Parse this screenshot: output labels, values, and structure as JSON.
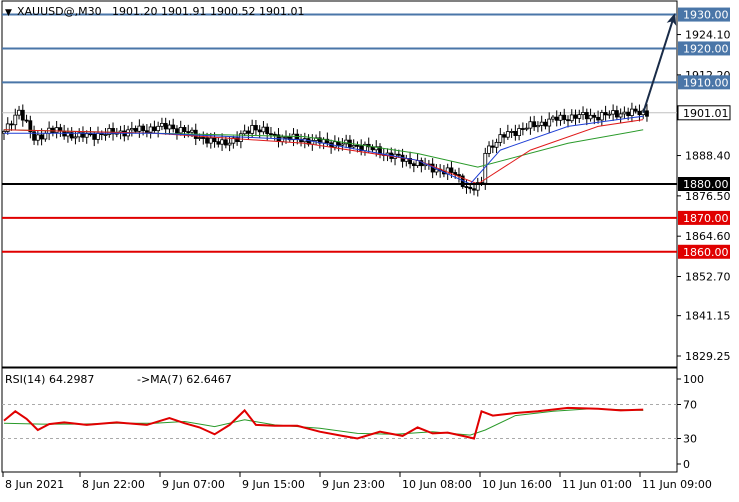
{
  "header": {
    "menu_glyph": "▼",
    "symbol": "XAUUSD@,M30",
    "ohlc": "1901.20 1901.91 1900.52 1901.01"
  },
  "colors": {
    "bull_candle": "#ffffff",
    "bear_candle": "#000000",
    "ma_fast": "#1f3fd6",
    "ma_mid": "#e01b1b",
    "ma_slow": "#2a9a2a",
    "level_blue": "#4a76a8",
    "level_red": "#e00000",
    "level_black": "#000000",
    "rsi_line": "#e00000",
    "rsi_ma": "#2a9a2a",
    "arrow": "#1a2c48"
  },
  "chart_data": [
    {
      "type": "candlestick",
      "title": "XAUUSD@,M30",
      "ylim": [
        1826,
        1934
      ],
      "y_ticks": [
        "1924.10",
        "1912.20",
        "1888.40",
        "1876.50",
        "1864.60",
        "1852.70",
        "1841.15",
        "1829.25"
      ],
      "x_ticks": [
        "8 Jun 2021",
        "8 Jun 22:00",
        "9 Jun 07:00",
        "9 Jun 15:00",
        "9 Jun 23:00",
        "10 Jun 08:00",
        "10 Jun 16:00",
        "11 Jun 01:00",
        "11 Jun 09:00"
      ],
      "current_price": "1901.01",
      "levels": [
        {
          "value": 1930.0,
          "label": "1930.00",
          "color": "blue"
        },
        {
          "value": 1920.0,
          "label": "1920.00",
          "color": "blue"
        },
        {
          "value": 1910.0,
          "label": "1910.00",
          "color": "blue"
        },
        {
          "value": 1880.0,
          "label": "1880.00",
          "color": "black"
        },
        {
          "value": 1870.0,
          "label": "1870.00",
          "color": "red"
        },
        {
          "value": 1860.0,
          "label": "1860.00",
          "color": "red"
        }
      ],
      "close_path": [
        [
          0,
          1895
        ],
        [
          4,
          1902
        ],
        [
          8,
          1893
        ],
        [
          12,
          1896
        ],
        [
          20,
          1894
        ],
        [
          28,
          1895
        ],
        [
          36,
          1896
        ],
        [
          44,
          1897
        ],
        [
          52,
          1894
        ],
        [
          56,
          1892
        ],
        [
          62,
          1893
        ],
        [
          66,
          1897
        ],
        [
          72,
          1894
        ],
        [
          80,
          1893
        ],
        [
          88,
          1892
        ],
        [
          96,
          1891
        ],
        [
          104,
          1888
        ],
        [
          110,
          1886
        ],
        [
          116,
          1884
        ],
        [
          120,
          1883
        ],
        [
          124,
          1878
        ],
        [
          127,
          1880
        ],
        [
          128,
          1890
        ],
        [
          134,
          1895
        ],
        [
          140,
          1897
        ],
        [
          146,
          1899
        ],
        [
          152,
          1900
        ],
        [
          158,
          1900
        ],
        [
          164,
          1901
        ],
        [
          170,
          1901
        ]
      ],
      "total_bars": 172,
      "ma_fast": [
        [
          0,
          1895
        ],
        [
          40,
          1895
        ],
        [
          80,
          1893
        ],
        [
          110,
          1887
        ],
        [
          124,
          1880
        ],
        [
          132,
          1890
        ],
        [
          150,
          1897
        ],
        [
          170,
          1900
        ]
      ],
      "ma_mid": [
        [
          0,
          1896
        ],
        [
          40,
          1895
        ],
        [
          80,
          1892
        ],
        [
          110,
          1887
        ],
        [
          126,
          1880
        ],
        [
          140,
          1890
        ],
        [
          158,
          1897
        ],
        [
          170,
          1899
        ]
      ],
      "ma_slow": [
        [
          0,
          1896
        ],
        [
          40,
          1895
        ],
        [
          80,
          1894
        ],
        [
          110,
          1889
        ],
        [
          126,
          1885
        ],
        [
          150,
          1892
        ],
        [
          170,
          1896
        ]
      ],
      "arrow": {
        "from": [
          170,
          1901
        ],
        "to": [
          178,
          1930
        ]
      }
    },
    {
      "type": "line",
      "title": "RSI(14) 64.2987",
      "subtitle": "->MA(7) 62.6467",
      "ylim": [
        0,
        100
      ],
      "y_ticks": [
        "100",
        "70",
        "30",
        "0"
      ],
      "guide_levels": [
        70,
        30
      ],
      "series": [
        {
          "name": "RSI(14)",
          "points": [
            [
              0,
              51
            ],
            [
              3,
              62
            ],
            [
              6,
              53
            ],
            [
              9,
              40
            ],
            [
              12,
              47
            ],
            [
              16,
              49
            ],
            [
              22,
              46
            ],
            [
              30,
              49
            ],
            [
              38,
              46
            ],
            [
              44,
              54
            ],
            [
              48,
              48
            ],
            [
              52,
              43
            ],
            [
              56,
              35
            ],
            [
              60,
              46
            ],
            [
              64,
              63
            ],
            [
              67,
              46
            ],
            [
              72,
              45
            ],
            [
              78,
              45
            ],
            [
              84,
              38
            ],
            [
              90,
              33
            ],
            [
              94,
              30
            ],
            [
              100,
              38
            ],
            [
              106,
              33
            ],
            [
              110,
              43
            ],
            [
              114,
              36
            ],
            [
              118,
              37
            ],
            [
              122,
              33
            ],
            [
              125,
              30
            ],
            [
              127,
              62
            ],
            [
              130,
              57
            ],
            [
              136,
              60
            ],
            [
              142,
              62
            ],
            [
              150,
              66
            ],
            [
              158,
              65
            ],
            [
              164,
              63
            ],
            [
              170,
              64
            ]
          ]
        },
        {
          "name": "MA(7)",
          "points": [
            [
              0,
              48
            ],
            [
              10,
              47
            ],
            [
              20,
              47
            ],
            [
              30,
              48
            ],
            [
              40,
              48
            ],
            [
              48,
              50
            ],
            [
              56,
              44
            ],
            [
              64,
              52
            ],
            [
              72,
              46
            ],
            [
              84,
              42
            ],
            [
              94,
              36
            ],
            [
              104,
              35
            ],
            [
              114,
              38
            ],
            [
              124,
              34
            ],
            [
              128,
              40
            ],
            [
              136,
              57
            ],
            [
              146,
              62
            ],
            [
              156,
              65
            ],
            [
              164,
              64
            ],
            [
              170,
              63
            ]
          ]
        }
      ]
    }
  ]
}
